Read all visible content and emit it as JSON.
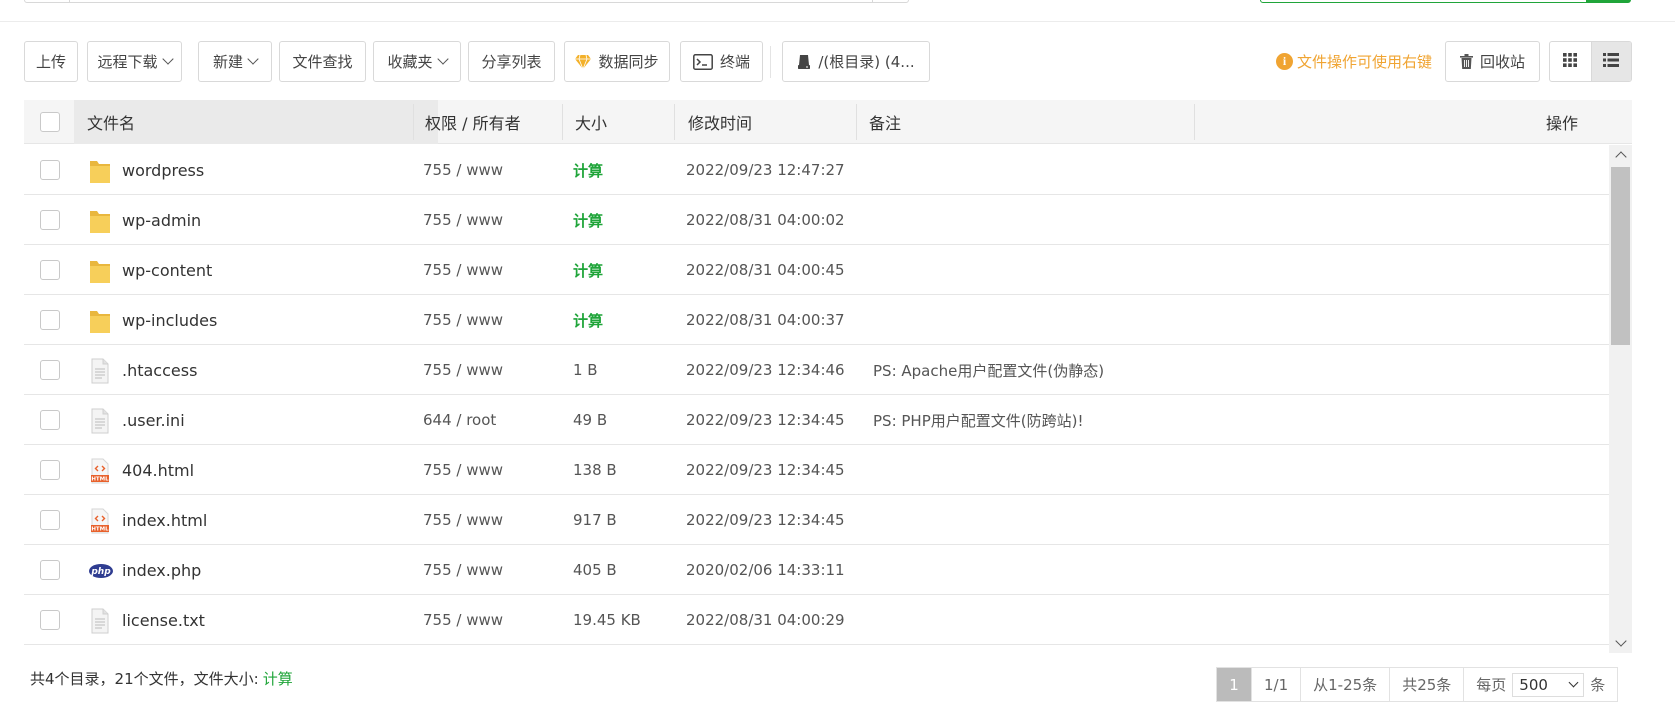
{
  "toolbar": {
    "upload": "上传",
    "remote_download": "远程下载",
    "new": "新建",
    "file_search": "文件查找",
    "favorites": "收藏夹",
    "share_list": "分享列表",
    "data_sync": "数据同步",
    "terminal": "终端",
    "path": "/(根目录) (4...",
    "hint": "文件操作可使用右键",
    "recycle_bin": "回收站",
    "view_icons": [
      "grid-view-icon",
      "list-view-icon"
    ],
    "active_view": "list"
  },
  "table": {
    "columns": {
      "name": "文件名",
      "perm": "权限 / 所有者",
      "size": "大小",
      "mtime": "修改时间",
      "note": "备注",
      "ops": "操作"
    },
    "rows": [
      {
        "name": "wordpress",
        "icon": "folder-icon",
        "perm": "755 / www",
        "size": "计算",
        "mtime": "2022/09/23 12:47:27",
        "note": ""
      },
      {
        "name": "wp-admin",
        "icon": "folder-icon",
        "perm": "755 / www",
        "size": "计算",
        "mtime": "2022/08/31 04:00:02",
        "note": ""
      },
      {
        "name": "wp-content",
        "icon": "folder-icon",
        "perm": "755 / www",
        "size": "计算",
        "mtime": "2022/08/31 04:00:45",
        "note": ""
      },
      {
        "name": "wp-includes",
        "icon": "folder-icon",
        "perm": "755 / www",
        "size": "计算",
        "mtime": "2022/08/31 04:00:37",
        "note": ""
      },
      {
        "name": ".htaccess",
        "icon": "text-file-icon",
        "perm": "755 / www",
        "size": "1 B",
        "mtime": "2022/09/23 12:34:46",
        "note": "PS: Apache用户配置文件(伪静态)"
      },
      {
        "name": ".user.ini",
        "icon": "text-file-icon",
        "perm": "644 / root",
        "size": "49 B",
        "mtime": "2022/09/23 12:34:45",
        "note": "PS: PHP用户配置文件(防跨站)!"
      },
      {
        "name": "404.html",
        "icon": "html-file-icon",
        "perm": "755 / www",
        "size": "138 B",
        "mtime": "2022/09/23 12:34:45",
        "note": ""
      },
      {
        "name": "index.html",
        "icon": "html-file-icon",
        "perm": "755 / www",
        "size": "917 B",
        "mtime": "2022/09/23 12:34:45",
        "note": ""
      },
      {
        "name": "index.php",
        "icon": "php-file-icon",
        "perm": "755 / www",
        "size": "405 B",
        "mtime": "2020/02/06 14:33:11",
        "note": ""
      },
      {
        "name": "license.txt",
        "icon": "text-file-icon",
        "perm": "755 / www",
        "size": "19.45 KB",
        "mtime": "2022/08/31 04:00:29",
        "note": ""
      }
    ]
  },
  "footer": {
    "summary": "共4个目录，21个文件，文件大小:",
    "calc": "计算",
    "current_page": "1",
    "page_of": "1/1",
    "range": "从1-25条",
    "total": "共25条",
    "per_page_label": "每页",
    "per_page_value": "500",
    "per_page_unit": "条"
  },
  "colors": {
    "accent_green": "#20a53a",
    "hint_orange": "#f0a432",
    "folder_yellow": "#f7cf5a",
    "php_blue": "#2f3d91",
    "html_orange": "#e8612c"
  }
}
